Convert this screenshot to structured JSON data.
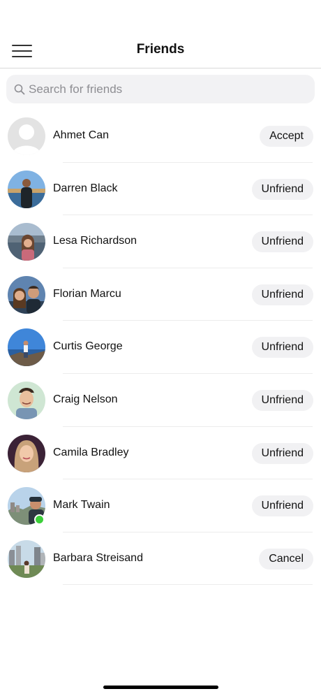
{
  "header": {
    "title": "Friends",
    "menu_icon": "hamburger-menu-icon"
  },
  "search": {
    "placeholder": "Search for friends",
    "value": "",
    "icon": "search-icon"
  },
  "friends": [
    {
      "name": "Ahmet Can",
      "action": "Accept",
      "online": false
    },
    {
      "name": "Darren Black",
      "action": "Unfriend",
      "online": false
    },
    {
      "name": "Lesa Richardson",
      "action": "Unfriend",
      "online": false
    },
    {
      "name": "Florian Marcu",
      "action": "Unfriend",
      "online": false
    },
    {
      "name": "Curtis George",
      "action": "Unfriend",
      "online": false
    },
    {
      "name": "Craig Nelson",
      "action": "Unfriend",
      "online": false
    },
    {
      "name": "Camila Bradley",
      "action": "Unfriend",
      "online": false
    },
    {
      "name": "Mark Twain",
      "action": "Unfriend",
      "online": true
    },
    {
      "name": "Barbara Streisand",
      "action": "Cancel",
      "online": false
    }
  ],
  "colors": {
    "online": "#3ccf3a",
    "button_bg": "#f1f1f3",
    "search_bg": "#f2f2f4"
  }
}
